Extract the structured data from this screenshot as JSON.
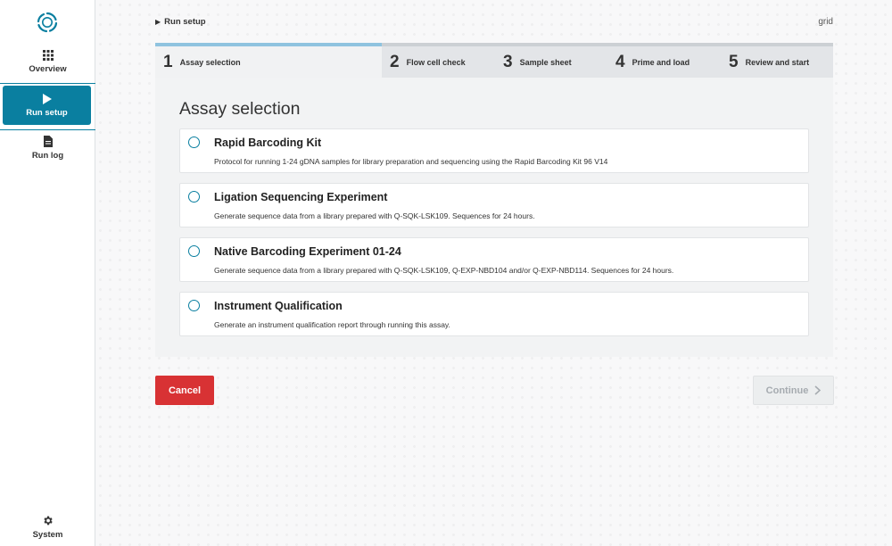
{
  "colors": {
    "accent": "#0a7fa0",
    "cancel": "#d83234",
    "disabled_text": "#a6abb0"
  },
  "sidebar": {
    "logo_icon": "nanopore-logo-icon",
    "items": [
      {
        "label": "Overview",
        "icon": "grid-icon",
        "active": false
      },
      {
        "label": "Run setup",
        "icon": "play-icon",
        "active": true
      },
      {
        "label": "Run log",
        "icon": "document-icon",
        "active": false
      }
    ],
    "system": {
      "label": "System",
      "icon": "gear-icon"
    }
  },
  "header": {
    "breadcrumb": "Run setup",
    "device": "grid"
  },
  "steps": [
    {
      "num": "1",
      "label": "Assay selection",
      "active": true
    },
    {
      "num": "2",
      "label": "Flow cell check",
      "active": false
    },
    {
      "num": "3",
      "label": "Sample sheet",
      "active": false
    },
    {
      "num": "4",
      "label": "Prime and load",
      "active": false
    },
    {
      "num": "5",
      "label": "Review and start",
      "active": false
    }
  ],
  "panel": {
    "title": "Assay selection",
    "options": [
      {
        "name": "Rapid Barcoding Kit",
        "desc": "Protocol for running 1-24 gDNA samples for library preparation and sequencing using the Rapid Barcoding Kit 96 V14"
      },
      {
        "name": "Ligation Sequencing Experiment",
        "desc": "Generate sequence data from a library prepared with Q-SQK-LSK109. Sequences for 24 hours."
      },
      {
        "name": "Native Barcoding Experiment 01-24",
        "desc": "Generate sequence data from a library prepared with Q-SQK-LSK109, Q-EXP-NBD104 and/or Q-EXP-NBD114. Sequences for 24 hours."
      },
      {
        "name": "Instrument Qualification",
        "desc": "Generate an instrument qualification report through running this assay."
      }
    ]
  },
  "actions": {
    "cancel": "Cancel",
    "continue": "Continue"
  }
}
